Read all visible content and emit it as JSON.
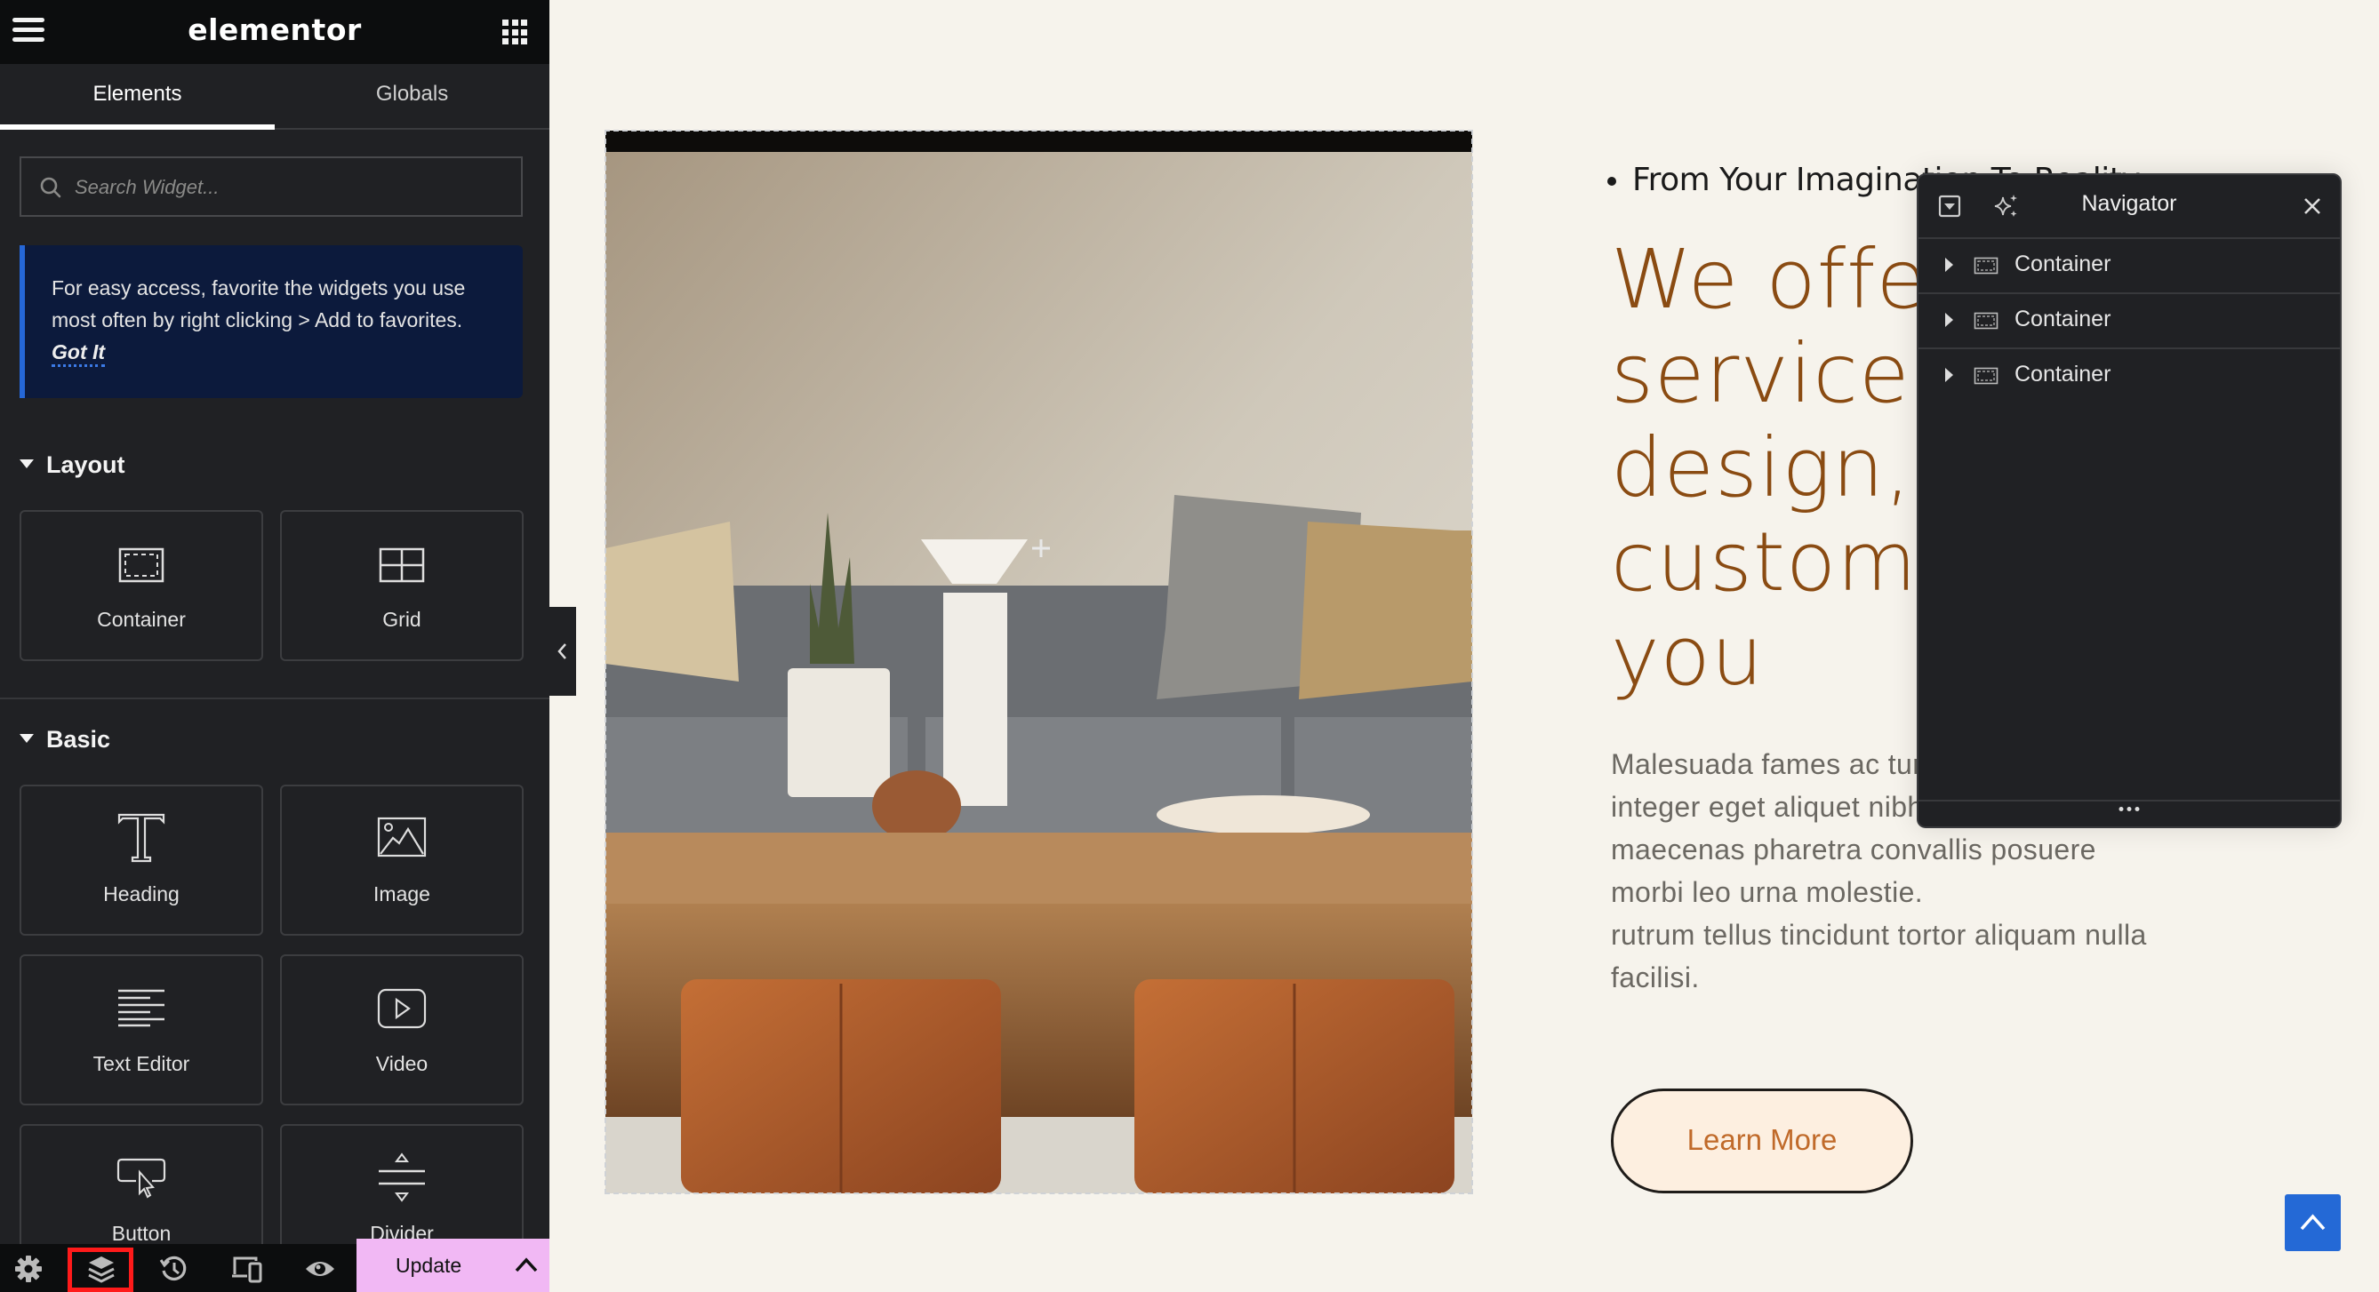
{
  "app": {
    "logo": "elementor",
    "tabs": [
      {
        "label": "Elements",
        "active": true
      },
      {
        "label": "Globals",
        "active": false
      }
    ],
    "search": {
      "placeholder": "Search Widget...",
      "value": ""
    },
    "tip": {
      "text": "For easy access, favorite the widgets you use most often by right clicking > Add to favorites.",
      "action": "Got It"
    },
    "sections": [
      {
        "title": "Layout",
        "widgets": [
          {
            "label": "Container",
            "icon": "container-icon"
          },
          {
            "label": "Grid",
            "icon": "grid-icon"
          }
        ]
      },
      {
        "title": "Basic",
        "widgets": [
          {
            "label": "Heading",
            "icon": "heading-icon"
          },
          {
            "label": "Image",
            "icon": "image-icon"
          },
          {
            "label": "Text Editor",
            "icon": "text-editor-icon"
          },
          {
            "label": "Video",
            "icon": "video-icon"
          },
          {
            "label": "Button",
            "icon": "button-icon"
          },
          {
            "label": "Divider",
            "icon": "divider-icon"
          }
        ]
      }
    ],
    "bottom_bar": {
      "icons": [
        "settings-icon",
        "layers-icon",
        "history-icon",
        "responsive-icon",
        "preview-icon"
      ],
      "highlighted": "layers-icon",
      "update_label": "Update"
    },
    "colors": {
      "panel": "#202124",
      "topbar": "#0c0d0e",
      "accent_blue": "#2567d8",
      "update_bg": "#f1b8f4",
      "highlight_red": "#ff1a1a"
    }
  },
  "canvas": {
    "bullet": "From Your Imagination To Reality",
    "headline_lines": [
      "We offer",
      "service in",
      "design,",
      "customiz",
      "you"
    ],
    "body_lines": [
      "Malesuada fames ac turpis egestas",
      "integer eget aliquet nibh praesent",
      "maecenas pharetra convallis posuere",
      "morbi leo urna molestie.",
      "rutrum tellus tincidunt tortor aliquam nulla",
      "facilisi."
    ],
    "button_label": "Learn More",
    "colors": {
      "background": "#f6f3ec",
      "headline": "#8a4b12",
      "body": "#6b6862",
      "button_bg": "#fdefe0",
      "button_text": "#c06a2a",
      "scroll_top": "#2469d6"
    }
  },
  "navigator": {
    "title": "Navigator",
    "items": [
      {
        "label": "Container"
      },
      {
        "label": "Container"
      },
      {
        "label": "Container"
      }
    ]
  }
}
